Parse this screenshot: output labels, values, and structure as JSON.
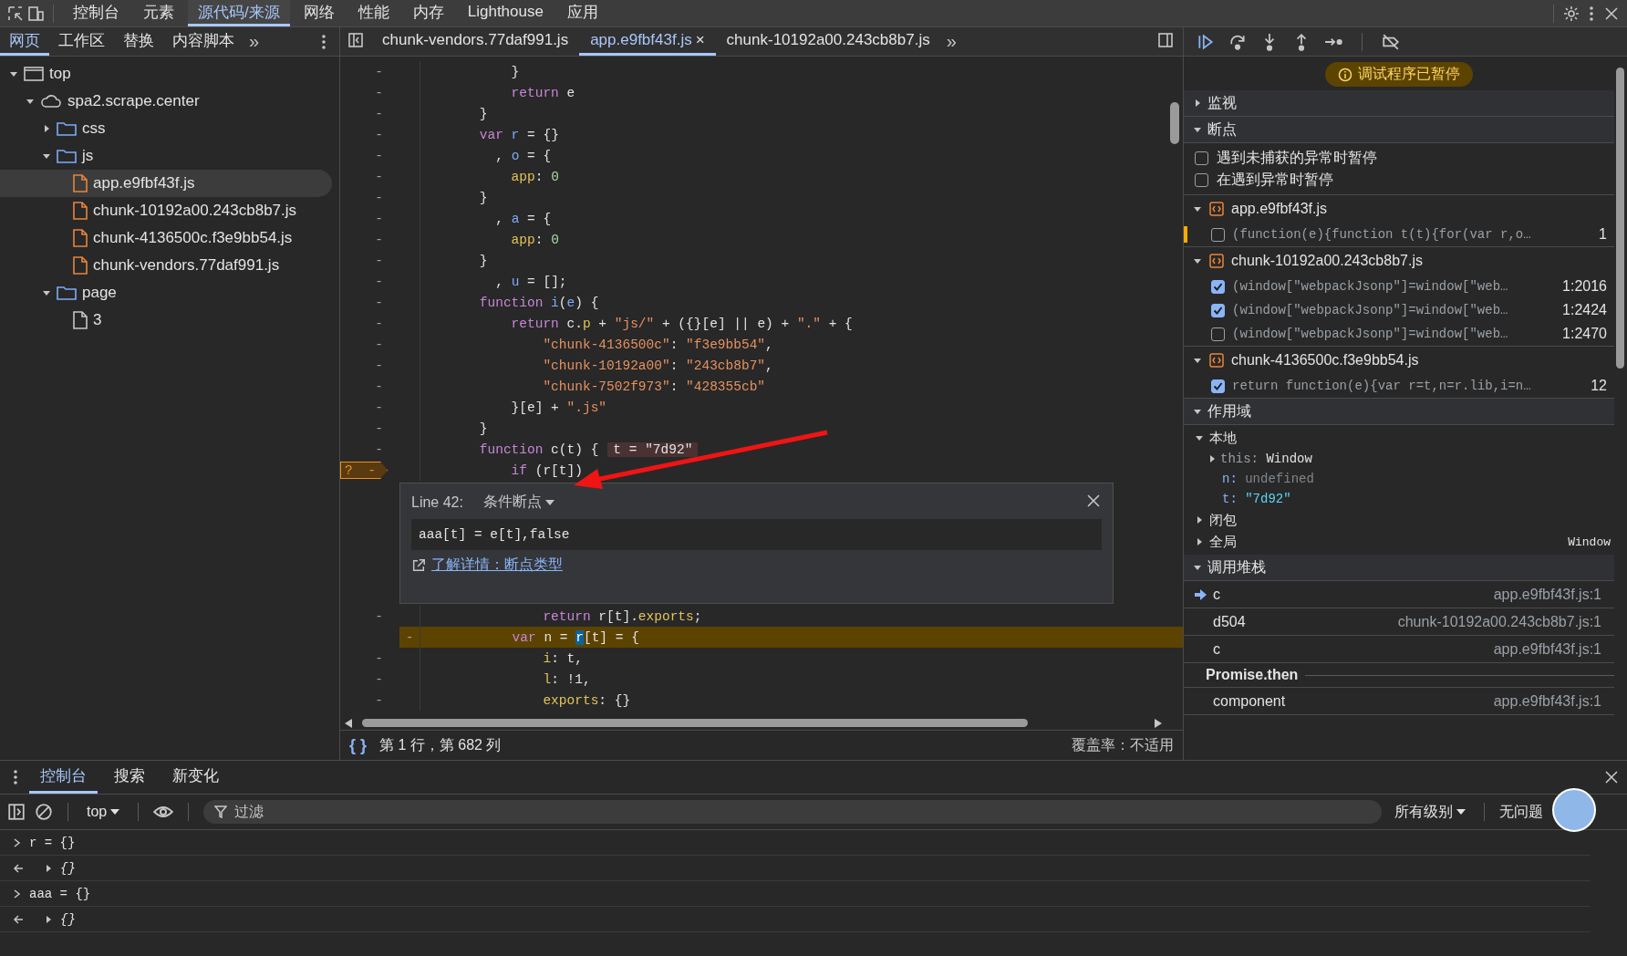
{
  "main_tabs": [
    {
      "label": "控制台",
      "selected": false
    },
    {
      "label": "元素",
      "selected": false
    },
    {
      "label": "源代码/来源",
      "selected": true
    },
    {
      "label": "网络",
      "selected": false
    },
    {
      "label": "性能",
      "selected": false
    },
    {
      "label": "内存",
      "selected": false
    },
    {
      "label": "Lighthouse",
      "selected": false
    },
    {
      "label": "应用",
      "selected": false
    }
  ],
  "navigator": {
    "tabs": [
      {
        "label": "网页",
        "selected": true
      },
      {
        "label": "工作区",
        "selected": false
      },
      {
        "label": "替换",
        "selected": false
      },
      {
        "label": "内容脚本",
        "selected": false
      }
    ],
    "more": "»",
    "tree": [
      {
        "label": "top",
        "kind": "frame",
        "expanded": true,
        "selected": false,
        "children": [
          {
            "label": "spa2.scrape.center",
            "kind": "domain",
            "expanded": true,
            "selected": false,
            "children": [
              {
                "label": "css",
                "kind": "folder",
                "expanded": false,
                "selected": false
              },
              {
                "label": "js",
                "kind": "folder",
                "expanded": true,
                "selected": false,
                "children": [
                  {
                    "label": "app.e9fbf43f.js",
                    "kind": "script",
                    "selected": true
                  },
                  {
                    "label": "chunk-10192a00.243cb8b7.js",
                    "kind": "script",
                    "selected": false
                  },
                  {
                    "label": "chunk-4136500c.f3e9bb54.js",
                    "kind": "script",
                    "selected": false
                  },
                  {
                    "label": "chunk-vendors.77daf991.js",
                    "kind": "script",
                    "selected": false
                  }
                ]
              },
              {
                "label": "page",
                "kind": "folder",
                "expanded": true,
                "selected": false,
                "children": [
                  {
                    "label": "3",
                    "kind": "document",
                    "selected": false
                  }
                ]
              }
            ]
          }
        ]
      }
    ]
  },
  "editor": {
    "tabs": [
      {
        "label": "chunk-vendors.77daf991.js",
        "selected": false
      },
      {
        "label": "app.e9fbf43f.js",
        "selected": true,
        "close": "×"
      },
      {
        "label": "chunk-10192a00.243cb8b7.js",
        "selected": false
      }
    ],
    "more": "»",
    "lines": [
      {
        "kind": "code",
        "gutter": "-",
        "tokens": [
          {
            "t": "        }",
            "kind": "plain"
          }
        ]
      },
      {
        "kind": "code",
        "gutter": "-",
        "tokens": [
          {
            "t": "        return",
            "kind": "kw"
          },
          {
            "t": " e",
            "kind": "plain"
          }
        ]
      },
      {
        "kind": "code",
        "gutter": "-",
        "tokens": [
          {
            "t": "    }",
            "kind": "plain"
          }
        ]
      },
      {
        "kind": "code",
        "gutter": "-",
        "tokens": [
          {
            "t": "    var",
            "kind": "kw"
          },
          {
            "t": " r",
            "kind": "var"
          },
          {
            "t": " = {}",
            "kind": "plain"
          }
        ]
      },
      {
        "kind": "code",
        "gutter": "-",
        "tokens": [
          {
            "t": "      , ",
            "kind": "plain"
          },
          {
            "t": "o",
            "kind": "var"
          },
          {
            "t": " = {",
            "kind": "plain"
          }
        ]
      },
      {
        "kind": "code",
        "gutter": "-",
        "tokens": [
          {
            "t": "        app",
            "kind": "prop"
          },
          {
            "t": ": ",
            "kind": "plain"
          },
          {
            "t": "0",
            "kind": "num"
          }
        ]
      },
      {
        "kind": "code",
        "gutter": "-",
        "tokens": [
          {
            "t": "    }",
            "kind": "plain"
          }
        ]
      },
      {
        "kind": "code",
        "gutter": "-",
        "tokens": [
          {
            "t": "      , ",
            "kind": "plain"
          },
          {
            "t": "a",
            "kind": "var"
          },
          {
            "t": " = {",
            "kind": "plain"
          }
        ]
      },
      {
        "kind": "code",
        "gutter": "-",
        "tokens": [
          {
            "t": "        app",
            "kind": "prop"
          },
          {
            "t": ": ",
            "kind": "plain"
          },
          {
            "t": "0",
            "kind": "num"
          }
        ]
      },
      {
        "kind": "code",
        "gutter": "-",
        "tokens": [
          {
            "t": "    }",
            "kind": "plain"
          }
        ]
      },
      {
        "kind": "code",
        "gutter": "-",
        "tokens": [
          {
            "t": "      , ",
            "kind": "plain"
          },
          {
            "t": "u",
            "kind": "var"
          },
          {
            "t": " = [];",
            "kind": "plain"
          }
        ]
      },
      {
        "kind": "code",
        "gutter": "-",
        "tokens": [
          {
            "t": "    function",
            "kind": "kw"
          },
          {
            "t": " i",
            "kind": "var"
          },
          {
            "t": "(",
            "kind": "plain"
          },
          {
            "t": "e",
            "kind": "var"
          },
          {
            "t": ") {",
            "kind": "plain"
          }
        ]
      },
      {
        "kind": "code",
        "gutter": "-",
        "tokens": [
          {
            "t": "        return",
            "kind": "kw"
          },
          {
            "t": " c.",
            "kind": "plain"
          },
          {
            "t": "p",
            "kind": "prop"
          },
          {
            "t": " + ",
            "kind": "plain"
          },
          {
            "t": "\"js/\"",
            "kind": "str"
          },
          {
            "t": " + ({}[e] || e) + ",
            "kind": "plain"
          },
          {
            "t": "\".\"",
            "kind": "str"
          },
          {
            "t": " + {",
            "kind": "plain"
          }
        ]
      },
      {
        "kind": "code",
        "gutter": "-",
        "tokens": [
          {
            "t": "            \"chunk-4136500c\"",
            "kind": "str"
          },
          {
            "t": ": ",
            "kind": "plain"
          },
          {
            "t": "\"f3e9bb54\"",
            "kind": "str"
          },
          {
            "t": ",",
            "kind": "plain"
          }
        ]
      },
      {
        "kind": "code",
        "gutter": "-",
        "tokens": [
          {
            "t": "            \"chunk-10192a00\"",
            "kind": "str"
          },
          {
            "t": ": ",
            "kind": "plain"
          },
          {
            "t": "\"243cb8b7\"",
            "kind": "str"
          },
          {
            "t": ",",
            "kind": "plain"
          }
        ]
      },
      {
        "kind": "code",
        "gutter": "-",
        "tokens": [
          {
            "t": "            \"chunk-7502f973\"",
            "kind": "str"
          },
          {
            "t": ": ",
            "kind": "plain"
          },
          {
            "t": "\"428355cb\"",
            "kind": "str"
          }
        ]
      },
      {
        "kind": "code",
        "gutter": "-",
        "tokens": [
          {
            "t": "        }[e] + ",
            "kind": "plain"
          },
          {
            "t": "\".js\"",
            "kind": "str"
          }
        ]
      },
      {
        "kind": "code",
        "gutter": "-",
        "tokens": [
          {
            "t": "    }",
            "kind": "plain"
          }
        ]
      },
      {
        "kind": "code",
        "gutter": "-",
        "tokens": [
          {
            "t": "    function",
            "kind": "kw"
          },
          {
            "t": " c(t) {",
            "kind": "plain"
          }
        ],
        "inline_value": "t = \"7d92\""
      },
      {
        "kind": "breakpoint",
        "gutter": "-",
        "marker": "?",
        "tokens": [
          {
            "t": "        if",
            "kind": "kw"
          },
          {
            "t": " (r[t])",
            "kind": "plain"
          }
        ]
      },
      {
        "kind": "popup"
      },
      {
        "kind": "code",
        "gutter": "-",
        "tokens": [
          {
            "t": "            return",
            "kind": "kw"
          },
          {
            "t": " r[t].",
            "kind": "plain"
          },
          {
            "t": "exports",
            "kind": "prop"
          },
          {
            "t": ";",
            "kind": "plain"
          }
        ]
      },
      {
        "kind": "paused",
        "gutter": "-",
        "tokens": [
          {
            "t": "        var",
            "kind": "kw"
          },
          {
            "t": " n = ",
            "kind": "plain"
          },
          {
            "t": "r",
            "kind": "sel"
          },
          {
            "t": "[t] = {",
            "kind": "plain"
          }
        ]
      },
      {
        "kind": "code",
        "gutter": "-",
        "tokens": [
          {
            "t": "            i",
            "kind": "prop"
          },
          {
            "t": ": t,",
            "kind": "plain"
          }
        ]
      },
      {
        "kind": "code",
        "gutter": "-",
        "tokens": [
          {
            "t": "            l",
            "kind": "prop"
          },
          {
            "t": ": !1,",
            "kind": "plain"
          }
        ]
      },
      {
        "kind": "code",
        "gutter": "-",
        "tokens": [
          {
            "t": "            exports",
            "kind": "prop"
          },
          {
            "t": ": {}",
            "kind": "plain"
          }
        ]
      }
    ],
    "breakpoint_editor": {
      "line": "Line 42:",
      "type": "条件断点",
      "condition": "aaa[t] = e[t],false",
      "link": "了解详情：断点类型"
    },
    "status": {
      "pretty_print": "{ }",
      "position": "第 1 行，第 682 列",
      "coverage": "覆盖率：不适用"
    }
  },
  "debugger": {
    "paused_banner": "调试程序已暂停",
    "watch": {
      "title": "监视",
      "expanded": false
    },
    "breakpoints": {
      "title": "断点",
      "expanded": true,
      "options": [
        {
          "label": "遇到未捕获的异常时暂停",
          "checked": false
        },
        {
          "label": "在遇到异常时暂停",
          "checked": false
        }
      ],
      "files": [
        {
          "name": "app.e9fbf43f.js",
          "items": [
            {
              "code": "(function(e){function t(t){for(var r,o…",
              "location": "1",
              "checked": false,
              "hit": true
            }
          ]
        },
        {
          "name": "chunk-10192a00.243cb8b7.js",
          "items": [
            {
              "code": "(window[\"webpackJsonp\"]=window[\"web…",
              "location": "1:2016",
              "checked": true,
              "hit": false
            },
            {
              "code": "(window[\"webpackJsonp\"]=window[\"web…",
              "location": "1:2424",
              "checked": true,
              "hit": false
            },
            {
              "code": "(window[\"webpackJsonp\"]=window[\"web…",
              "location": "1:2470",
              "checked": false,
              "hit": false
            }
          ]
        },
        {
          "name": "chunk-4136500c.f3e9bb54.js",
          "items": [
            {
              "code": "return function(e){var r=t,n=r.lib,i=n…",
              "location": "12",
              "checked": true,
              "hit": false
            }
          ]
        }
      ]
    },
    "scope": {
      "title": "作用域",
      "expanded": true,
      "local": {
        "title": "本地",
        "vars": [
          {
            "name": "this:",
            "value": "Window",
            "kind": "object"
          },
          {
            "name": "n:",
            "value": "undefined",
            "kind": "undefined"
          },
          {
            "name": "t:",
            "value": "\"7d92\"",
            "kind": "string"
          }
        ]
      },
      "others": [
        {
          "title": "闭包"
        },
        {
          "title": "全局",
          "value": "Window"
        }
      ]
    },
    "call_stack": {
      "title": "调用堆栈",
      "frames": [
        {
          "name": "c",
          "location": "app.e9fbf43f.js:1",
          "kind": "frame",
          "current": true
        },
        {
          "name": "d504",
          "location": "chunk-10192a00.243cb8b7.js:1",
          "kind": "frame",
          "current": false
        },
        {
          "name": "c",
          "location": "app.e9fbf43f.js:1",
          "kind": "frame",
          "current": false
        },
        {
          "name": "Promise.then",
          "kind": "async"
        },
        {
          "name": "component",
          "location": "app.e9fbf43f.js:1",
          "kind": "frame",
          "current": false
        }
      ]
    }
  },
  "drawer": {
    "tabs": [
      {
        "label": "控制台",
        "selected": true
      },
      {
        "label": "搜索",
        "selected": false
      },
      {
        "label": "新变化",
        "selected": false
      }
    ],
    "context": "top",
    "filter_placeholder": "过滤",
    "levels": "所有级别",
    "issues": "无问题",
    "messages": [
      {
        "kind": "input",
        "text": "r = {}"
      },
      {
        "kind": "output",
        "text": "{}"
      },
      {
        "kind": "input",
        "text": "aaa = {}"
      },
      {
        "kind": "output",
        "text": "{}"
      }
    ]
  }
}
